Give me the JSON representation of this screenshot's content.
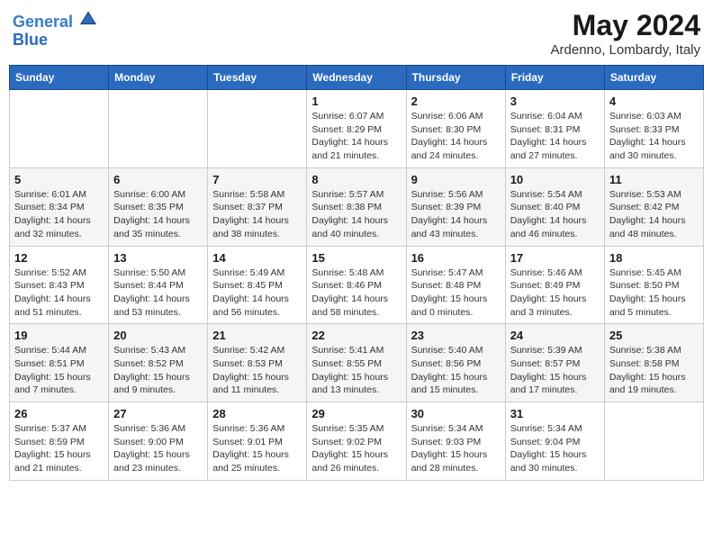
{
  "header": {
    "logo_line1": "General",
    "logo_line2": "Blue",
    "month_year": "May 2024",
    "location": "Ardenno, Lombardy, Italy"
  },
  "weekdays": [
    "Sunday",
    "Monday",
    "Tuesday",
    "Wednesday",
    "Thursday",
    "Friday",
    "Saturday"
  ],
  "weeks": [
    [
      {
        "day": "",
        "info": ""
      },
      {
        "day": "",
        "info": ""
      },
      {
        "day": "",
        "info": ""
      },
      {
        "day": "1",
        "info": "Sunrise: 6:07 AM\nSunset: 8:29 PM\nDaylight: 14 hours\nand 21 minutes."
      },
      {
        "day": "2",
        "info": "Sunrise: 6:06 AM\nSunset: 8:30 PM\nDaylight: 14 hours\nand 24 minutes."
      },
      {
        "day": "3",
        "info": "Sunrise: 6:04 AM\nSunset: 8:31 PM\nDaylight: 14 hours\nand 27 minutes."
      },
      {
        "day": "4",
        "info": "Sunrise: 6:03 AM\nSunset: 8:33 PM\nDaylight: 14 hours\nand 30 minutes."
      }
    ],
    [
      {
        "day": "5",
        "info": "Sunrise: 6:01 AM\nSunset: 8:34 PM\nDaylight: 14 hours\nand 32 minutes."
      },
      {
        "day": "6",
        "info": "Sunrise: 6:00 AM\nSunset: 8:35 PM\nDaylight: 14 hours\nand 35 minutes."
      },
      {
        "day": "7",
        "info": "Sunrise: 5:58 AM\nSunset: 8:37 PM\nDaylight: 14 hours\nand 38 minutes."
      },
      {
        "day": "8",
        "info": "Sunrise: 5:57 AM\nSunset: 8:38 PM\nDaylight: 14 hours\nand 40 minutes."
      },
      {
        "day": "9",
        "info": "Sunrise: 5:56 AM\nSunset: 8:39 PM\nDaylight: 14 hours\nand 43 minutes."
      },
      {
        "day": "10",
        "info": "Sunrise: 5:54 AM\nSunset: 8:40 PM\nDaylight: 14 hours\nand 46 minutes."
      },
      {
        "day": "11",
        "info": "Sunrise: 5:53 AM\nSunset: 8:42 PM\nDaylight: 14 hours\nand 48 minutes."
      }
    ],
    [
      {
        "day": "12",
        "info": "Sunrise: 5:52 AM\nSunset: 8:43 PM\nDaylight: 14 hours\nand 51 minutes."
      },
      {
        "day": "13",
        "info": "Sunrise: 5:50 AM\nSunset: 8:44 PM\nDaylight: 14 hours\nand 53 minutes."
      },
      {
        "day": "14",
        "info": "Sunrise: 5:49 AM\nSunset: 8:45 PM\nDaylight: 14 hours\nand 56 minutes."
      },
      {
        "day": "15",
        "info": "Sunrise: 5:48 AM\nSunset: 8:46 PM\nDaylight: 14 hours\nand 58 minutes."
      },
      {
        "day": "16",
        "info": "Sunrise: 5:47 AM\nSunset: 8:48 PM\nDaylight: 15 hours\nand 0 minutes."
      },
      {
        "day": "17",
        "info": "Sunrise: 5:46 AM\nSunset: 8:49 PM\nDaylight: 15 hours\nand 3 minutes."
      },
      {
        "day": "18",
        "info": "Sunrise: 5:45 AM\nSunset: 8:50 PM\nDaylight: 15 hours\nand 5 minutes."
      }
    ],
    [
      {
        "day": "19",
        "info": "Sunrise: 5:44 AM\nSunset: 8:51 PM\nDaylight: 15 hours\nand 7 minutes."
      },
      {
        "day": "20",
        "info": "Sunrise: 5:43 AM\nSunset: 8:52 PM\nDaylight: 15 hours\nand 9 minutes."
      },
      {
        "day": "21",
        "info": "Sunrise: 5:42 AM\nSunset: 8:53 PM\nDaylight: 15 hours\nand 11 minutes."
      },
      {
        "day": "22",
        "info": "Sunrise: 5:41 AM\nSunset: 8:55 PM\nDaylight: 15 hours\nand 13 minutes."
      },
      {
        "day": "23",
        "info": "Sunrise: 5:40 AM\nSunset: 8:56 PM\nDaylight: 15 hours\nand 15 minutes."
      },
      {
        "day": "24",
        "info": "Sunrise: 5:39 AM\nSunset: 8:57 PM\nDaylight: 15 hours\nand 17 minutes."
      },
      {
        "day": "25",
        "info": "Sunrise: 5:38 AM\nSunset: 8:58 PM\nDaylight: 15 hours\nand 19 minutes."
      }
    ],
    [
      {
        "day": "26",
        "info": "Sunrise: 5:37 AM\nSunset: 8:59 PM\nDaylight: 15 hours\nand 21 minutes."
      },
      {
        "day": "27",
        "info": "Sunrise: 5:36 AM\nSunset: 9:00 PM\nDaylight: 15 hours\nand 23 minutes."
      },
      {
        "day": "28",
        "info": "Sunrise: 5:36 AM\nSunset: 9:01 PM\nDaylight: 15 hours\nand 25 minutes."
      },
      {
        "day": "29",
        "info": "Sunrise: 5:35 AM\nSunset: 9:02 PM\nDaylight: 15 hours\nand 26 minutes."
      },
      {
        "day": "30",
        "info": "Sunrise: 5:34 AM\nSunset: 9:03 PM\nDaylight: 15 hours\nand 28 minutes."
      },
      {
        "day": "31",
        "info": "Sunrise: 5:34 AM\nSunset: 9:04 PM\nDaylight: 15 hours\nand 30 minutes."
      },
      {
        "day": "",
        "info": ""
      }
    ]
  ]
}
